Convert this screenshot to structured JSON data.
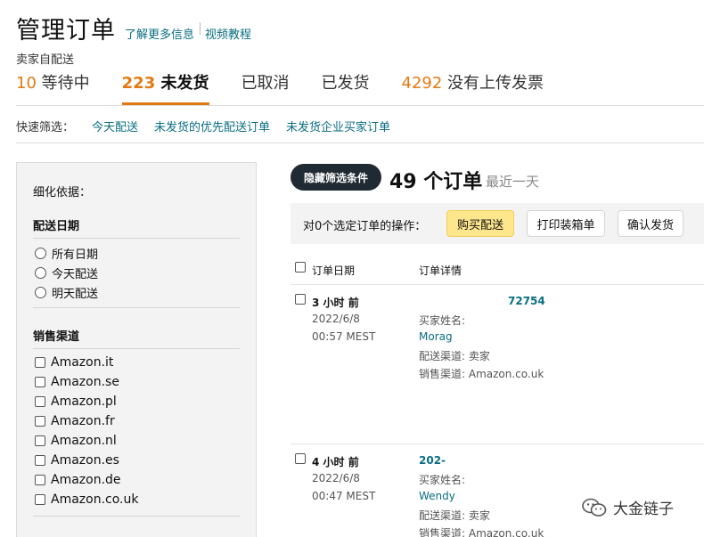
{
  "header": {
    "title": "管理订单",
    "link_more": "了解更多信息",
    "link_video": "视频教程",
    "subtitle": "卖家自配送"
  },
  "tabs": [
    {
      "count": "10",
      "label": " 等待中",
      "active": false
    },
    {
      "count": "223",
      "label": " 未发货",
      "active": true
    },
    {
      "count": "",
      "label": "已取消",
      "active": false
    },
    {
      "count": "",
      "label": "已发货",
      "active": false
    },
    {
      "count": "4292",
      "label": " 没有上传发票",
      "active": false
    }
  ],
  "quick_filter": {
    "label": "快速筛选：",
    "links": [
      "今天配送",
      "未发货的优先配送订单",
      "未发货企业买家订单"
    ]
  },
  "sidebar": {
    "heading": "细化依据：",
    "ship_date_title": "配送日期",
    "ship_date_options": [
      "所有日期",
      "今天配送",
      "明天配送"
    ],
    "channel_title": "销售渠道",
    "channel_options": [
      "Amazon.it",
      "Amazon.se",
      "Amazon.pl",
      "Amazon.fr",
      "Amazon.nl",
      "Amazon.es",
      "Amazon.de",
      "Amazon.co.uk"
    ]
  },
  "results": {
    "hide_filters_label": "隐藏筛选条件",
    "count_label": "49 个订单",
    "range_label": "最近一天"
  },
  "action_bar": {
    "label": "对0个选定订单的操作：",
    "buy_shipping": "购买配送",
    "print_packing": "打印装箱单",
    "confirm_ship": "确认发货"
  },
  "list_header": {
    "date": "订单日期",
    "details": "订单详情"
  },
  "orders": [
    {
      "ago": "3 小时 前",
      "date": "2022/6/8",
      "time": "00:57 MEST",
      "order_id": "72754",
      "buyer_label": "买家姓名:",
      "buyer": "Morag",
      "fulfilment": "配送渠道: 卖家",
      "channel": "销售渠道: Amazon.co.uk"
    },
    {
      "ago": "4 小时 前",
      "date": "2022/6/8",
      "time": "00:47 MEST",
      "order_id": "202-",
      "buyer_label": "买家姓名:",
      "buyer": "Wendy",
      "fulfilment": "配送渠道: 卖家",
      "channel": "销售渠道: Amazon.co.uk"
    }
  ],
  "watermark": {
    "text": "大金链子",
    "icon": "wechat-icon"
  },
  "colors": {
    "accent": "#e47911",
    "link": "#0a6d82",
    "primary_button": "#fde68b",
    "dark_pill": "#1f2a33"
  }
}
